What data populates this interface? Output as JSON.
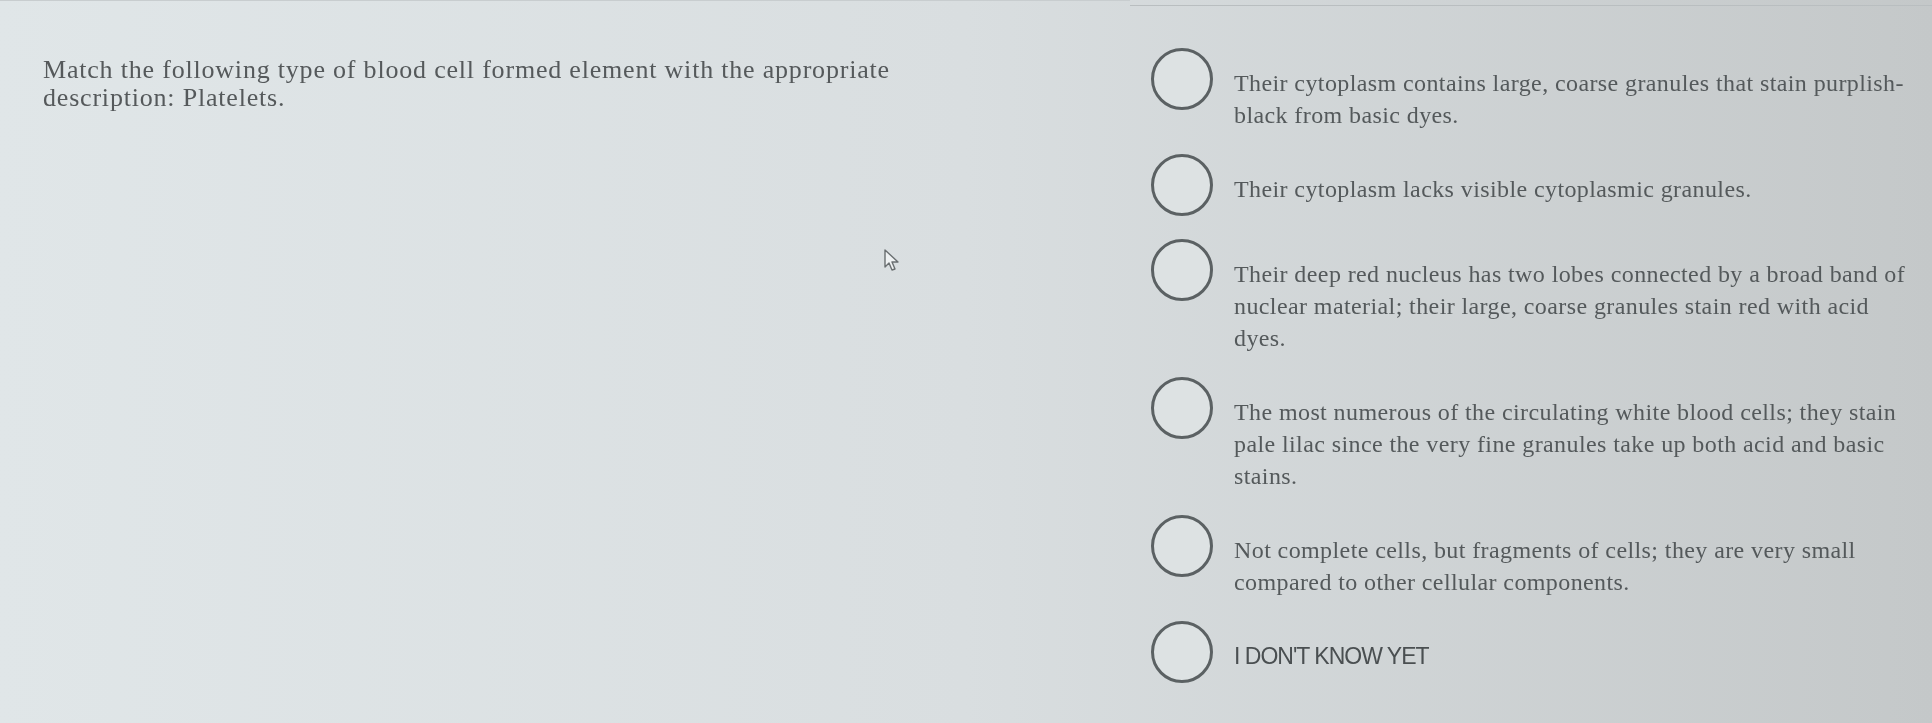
{
  "question": {
    "text": "Match the following type of blood cell formed element with the appropriate description: Platelets."
  },
  "options": [
    {
      "kind": "description",
      "label": "Their cytoplasm contains large, coarse granules that stain purplish-black from basic dyes.",
      "selected": false
    },
    {
      "kind": "description",
      "label": "Their cytoplasm lacks visible cytoplasmic granules.",
      "selected": false
    },
    {
      "kind": "description",
      "label": "Their deep red nucleus has two lobes connected by a broad band of nuclear material; their large, coarse granules stain red with acid dyes.",
      "selected": false
    },
    {
      "kind": "description",
      "label": "The most numerous of the circulating white blood cells; they stain pale lilac since the very fine granules take up both acid and basic stains.",
      "selected": false
    },
    {
      "kind": "description",
      "label": "Not complete cells, but fragments of cells; they are very small compared to other cellular components.",
      "selected": false
    },
    {
      "kind": "dont_know",
      "label": "I DON'T KNOW YET",
      "selected": false
    }
  ]
}
